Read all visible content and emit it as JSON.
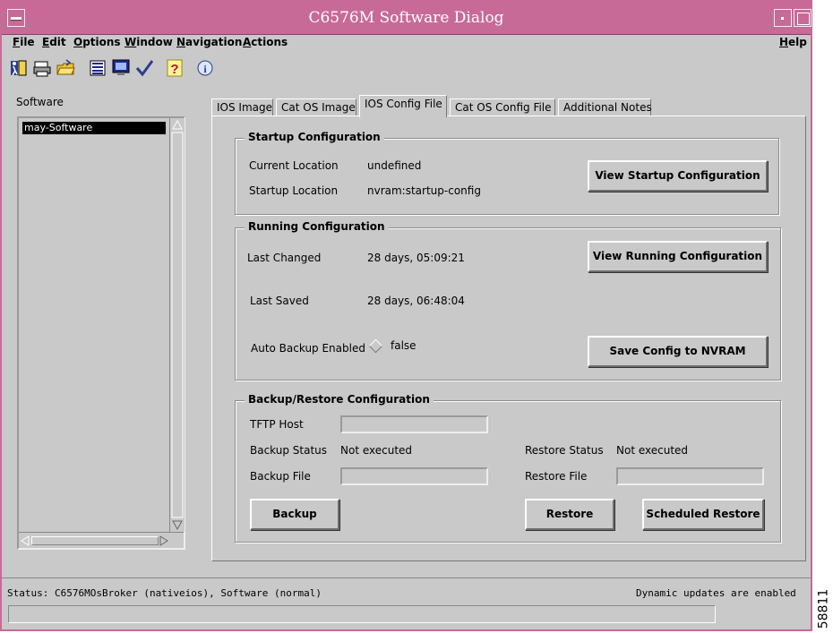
{
  "window": {
    "title": "C6576M Software Dialog"
  },
  "menubar": {
    "items": [
      "File",
      "Edit",
      "Options",
      "Window",
      "Navigation",
      "Actions"
    ],
    "help": "Help"
  },
  "toolbar": {
    "icons": [
      "exit-icon",
      "print-icon",
      "open-folder-icon",
      "list-icon",
      "monitor-icon",
      "checkmark-icon",
      "help-question-icon",
      "info-icon"
    ]
  },
  "sidebar": {
    "label": "Software",
    "items": [
      "may-Software"
    ]
  },
  "tabs": [
    "IOS Image",
    "Cat OS Image",
    "IOS Config File",
    "Cat OS Config File",
    "Additional Notes"
  ],
  "active_tab": "IOS Config File",
  "startup": {
    "title": "Startup Configuration",
    "current_location_label": "Current Location",
    "current_location_value": "undefined",
    "startup_location_label": "Startup Location",
    "startup_location_value": "nvram:startup-config",
    "view_button": "View Startup Configuration"
  },
  "running": {
    "title": "Running Configuration",
    "last_changed_label": "Last Changed",
    "last_changed_value": "28 days, 05:09:21",
    "last_saved_label": "Last Saved",
    "last_saved_value": "28 days, 06:48:04",
    "auto_backup_label": "Auto Backup Enabled",
    "auto_backup_value": "false",
    "view_button": "View Running Configuration",
    "save_button": "Save Config to NVRAM"
  },
  "backup": {
    "title": "Backup/Restore Configuration",
    "tftp_host_label": "TFTP Host",
    "tftp_host_value": "",
    "backup_status_label": "Backup Status",
    "backup_status_value": "Not executed",
    "restore_status_label": "Restore Status",
    "restore_status_value": "Not executed",
    "backup_file_label": "Backup File",
    "backup_file_value": "",
    "restore_file_label": "Restore File",
    "restore_file_value": "",
    "backup_button": "Backup",
    "restore_button": "Restore",
    "scheduled_restore_button": "Scheduled Restore"
  },
  "status": {
    "left": "Status: C6576MOsBroker (nativeios), Software (normal)",
    "right": "Dynamic updates are enabled"
  },
  "figure_id": "58811",
  "colors": {
    "titlebar": "#c86a98",
    "background": "#c9c9c9"
  }
}
